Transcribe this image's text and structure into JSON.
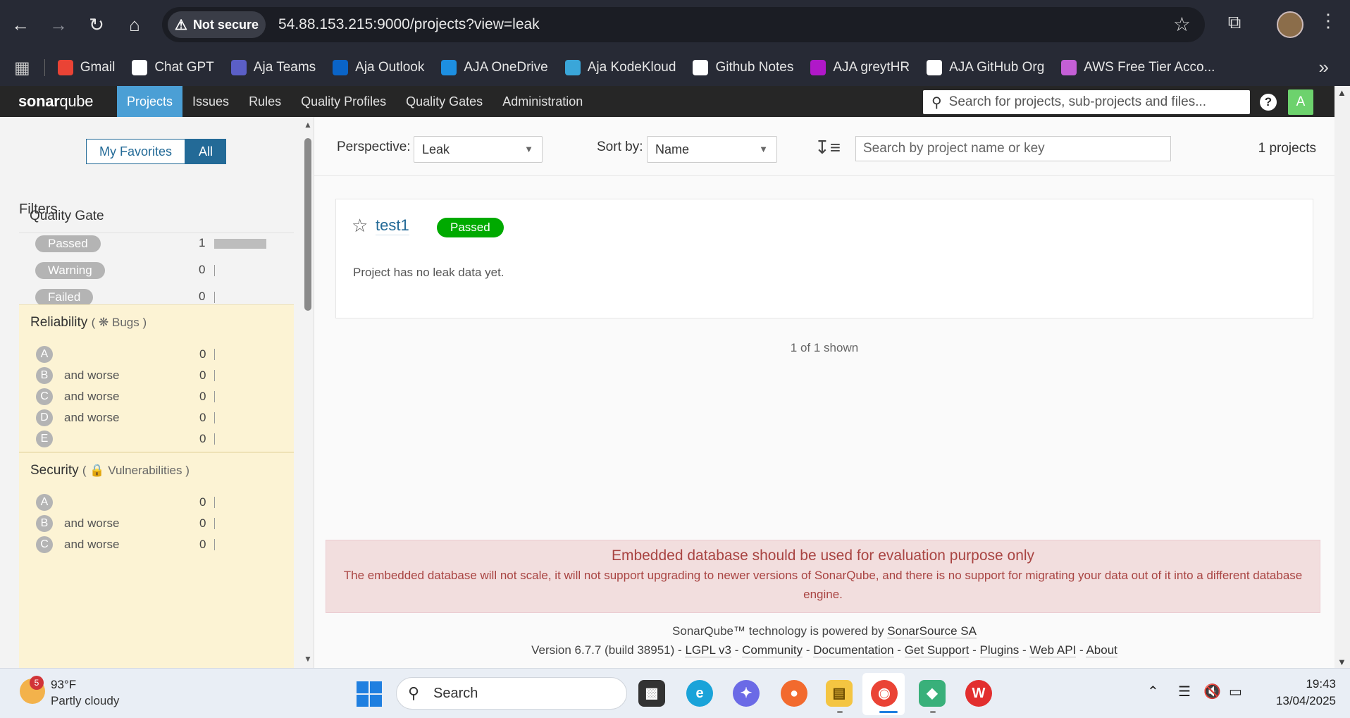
{
  "browser": {
    "security_label": "Not secure",
    "url": "54.88.153.215:9000/projects?view=leak",
    "bookmarks": [
      {
        "label": "Gmail",
        "icon": "gmail-icon",
        "color": "#ea4335"
      },
      {
        "label": "Chat GPT",
        "icon": "chatgpt-icon",
        "color": "#ffffff"
      },
      {
        "label": "Aja Teams",
        "icon": "teams-icon",
        "color": "#5b5fc7"
      },
      {
        "label": "Aja Outlook",
        "icon": "outlook-icon",
        "color": "#0a64c7"
      },
      {
        "label": "AJA OneDrive",
        "icon": "onedrive-icon",
        "color": "#1d8fe1"
      },
      {
        "label": "Aja KodeKloud",
        "icon": "kodekloud-icon",
        "color": "#3aa6d9"
      },
      {
        "label": "Github Notes",
        "icon": "github-icon",
        "color": "#ffffff"
      },
      {
        "label": "AJA greytHR",
        "icon": "greythr-icon",
        "color": "#b018c9"
      },
      {
        "label": "AJA GitHub Org",
        "icon": "github-icon",
        "color": "#ffffff"
      },
      {
        "label": "AWS Free Tier Acco...",
        "icon": "aws-cube-icon",
        "color": "#c45fd6"
      }
    ]
  },
  "nav": {
    "logo_a": "sonar",
    "logo_b": "qube",
    "tabs": [
      "Projects",
      "Issues",
      "Rules",
      "Quality Profiles",
      "Quality Gates",
      "Administration"
    ],
    "search_placeholder": "Search for projects, sub-projects and files...",
    "help": "?",
    "user_initial": "A"
  },
  "sidebar": {
    "toggle": {
      "favorites": "My Favorites",
      "all": "All"
    },
    "filters_heading": "Filters",
    "quality_gate": {
      "title": "Quality Gate",
      "rows": [
        {
          "label": "Passed",
          "count": "1",
          "fraction": 1.0
        },
        {
          "label": "Warning",
          "count": "0",
          "fraction": 0
        },
        {
          "label": "Failed",
          "count": "0",
          "fraction": 0
        }
      ]
    },
    "reliability": {
      "title": "Reliability",
      "paren_open": "(",
      "sub": "Bugs",
      "paren_close": ")",
      "rows": [
        {
          "rating": "A",
          "label": "",
          "count": "0"
        },
        {
          "rating": "B",
          "label": "and worse",
          "count": "0"
        },
        {
          "rating": "C",
          "label": "and worse",
          "count": "0"
        },
        {
          "rating": "D",
          "label": "and worse",
          "count": "0"
        },
        {
          "rating": "E",
          "label": "",
          "count": "0"
        }
      ]
    },
    "security": {
      "title": "Security",
      "paren_open": "(",
      "sub": "Vulnerabilities",
      "paren_close": ")",
      "rows": [
        {
          "rating": "A",
          "label": "",
          "count": "0"
        },
        {
          "rating": "B",
          "label": "and worse",
          "count": "0"
        },
        {
          "rating": "C",
          "label": "and worse",
          "count": "0"
        }
      ]
    }
  },
  "main": {
    "perspective_label": "Perspective:",
    "perspective_value": "Leak",
    "sort_label": "Sort by:",
    "sort_value": "Name",
    "search_placeholder": "Search by project name or key",
    "count_text": "1 projects",
    "project": {
      "name": "test1",
      "status": "Passed",
      "leak_text": "Project has no leak data yet."
    },
    "shown_text": "1 of 1 shown",
    "warning": {
      "title": "Embedded database should be used for evaluation purpose only",
      "body": "The embedded database will not scale, it will not support upgrading to newer versions of SonarQube, and there is no support for migrating your data out of it into a different database engine."
    },
    "footer": {
      "powered_prefix": "SonarQube™ technology is powered by",
      "powered_link": "SonarSource SA",
      "version": "Version 6.7.7 (build 38951)",
      "sep": "-",
      "links": [
        "LGPL v3",
        "Community",
        "Documentation",
        "Get Support",
        "Plugins",
        "Web API",
        "About"
      ]
    }
  },
  "taskbar": {
    "weather_badge": "5",
    "temperature": "93°F",
    "weather_desc": "Partly cloudy",
    "search_placeholder": "Search",
    "time": "19:43",
    "date": "13/04/2025"
  },
  "colors": {
    "accent": "#4b9fd5",
    "passed": "#00aa00",
    "link": "#236a97"
  }
}
